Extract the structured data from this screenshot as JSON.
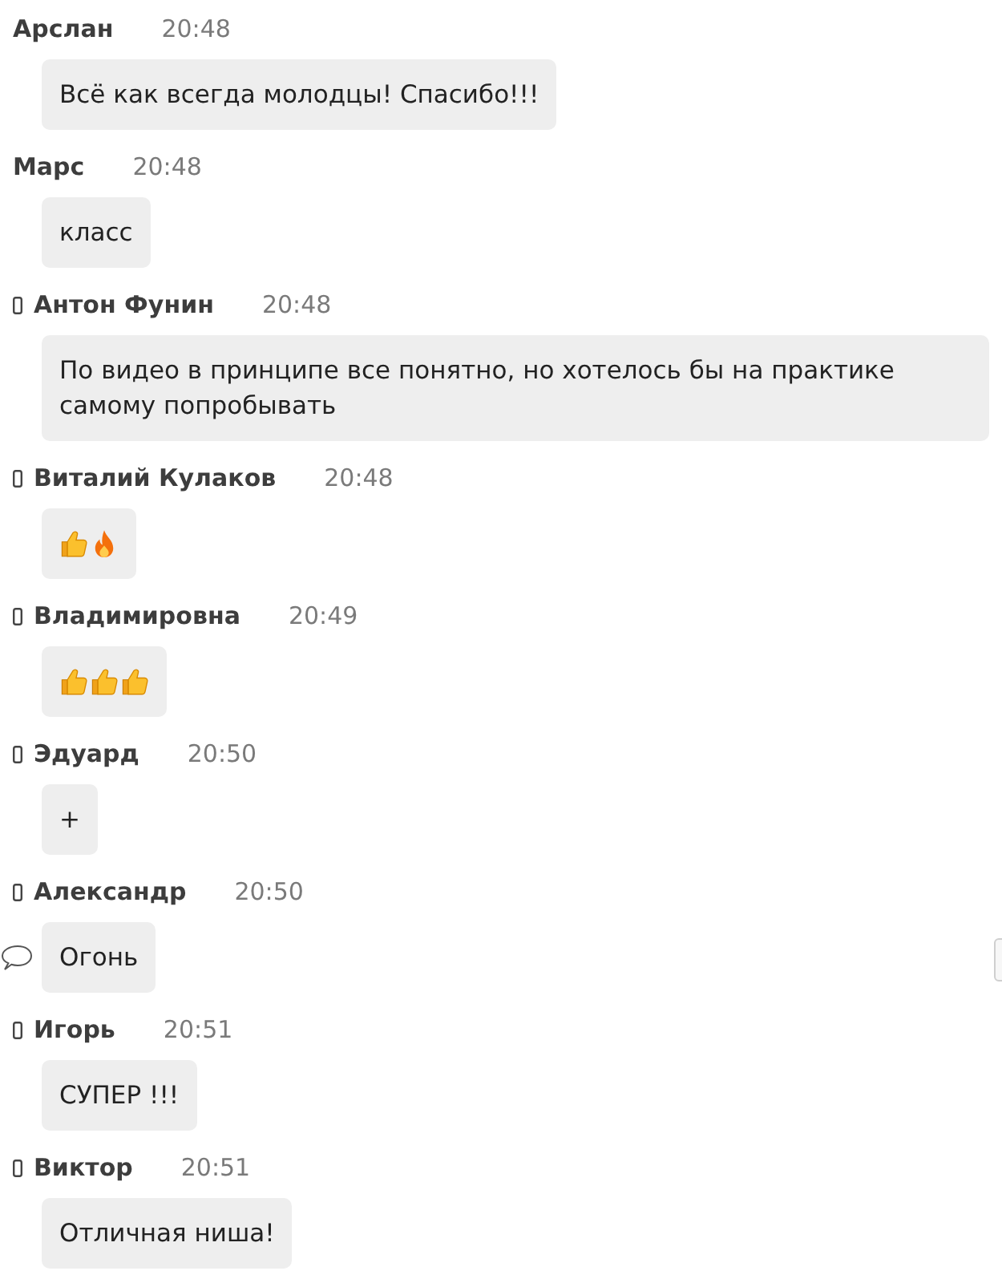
{
  "messages": [
    {
      "author": "Арслан",
      "time": "20:48",
      "device_icon": false,
      "reply_icon": false,
      "kind": "text",
      "text": "Всё как всегда молодцы! Спасибо!!!"
    },
    {
      "author": "Марс",
      "time": "20:48",
      "device_icon": false,
      "reply_icon": false,
      "kind": "text",
      "text": "класс"
    },
    {
      "author": "Антон Фунин",
      "time": "20:48",
      "device_icon": true,
      "reply_icon": false,
      "kind": "text",
      "text": "По видео в принципе все понятно, но хотелось бы на практике самому попробывать"
    },
    {
      "author": "Виталий Кулаков",
      "time": "20:48",
      "device_icon": true,
      "reply_icon": false,
      "kind": "emoji",
      "emojis": [
        {
          "kind": "thumbs_up"
        },
        {
          "kind": "fire"
        }
      ]
    },
    {
      "author": "Владимировна",
      "time": "20:49",
      "device_icon": true,
      "reply_icon": false,
      "kind": "emoji",
      "emojis": [
        {
          "kind": "thumbs_up"
        },
        {
          "kind": "thumbs_up"
        },
        {
          "kind": "thumbs_up"
        }
      ]
    },
    {
      "author": "Эдуард",
      "time": "20:50",
      "device_icon": true,
      "reply_icon": false,
      "kind": "text",
      "text": "+"
    },
    {
      "author": "Александр",
      "time": "20:50",
      "device_icon": true,
      "reply_icon": true,
      "kind": "text",
      "text": "Огонь"
    },
    {
      "author": "Игорь",
      "time": "20:51",
      "device_icon": true,
      "reply_icon": false,
      "kind": "text",
      "text": "СУПЕР !!!"
    },
    {
      "author": "Виктор",
      "time": "20:51",
      "device_icon": true,
      "reply_icon": false,
      "kind": "text",
      "text": "Отличная ниша!"
    }
  ]
}
